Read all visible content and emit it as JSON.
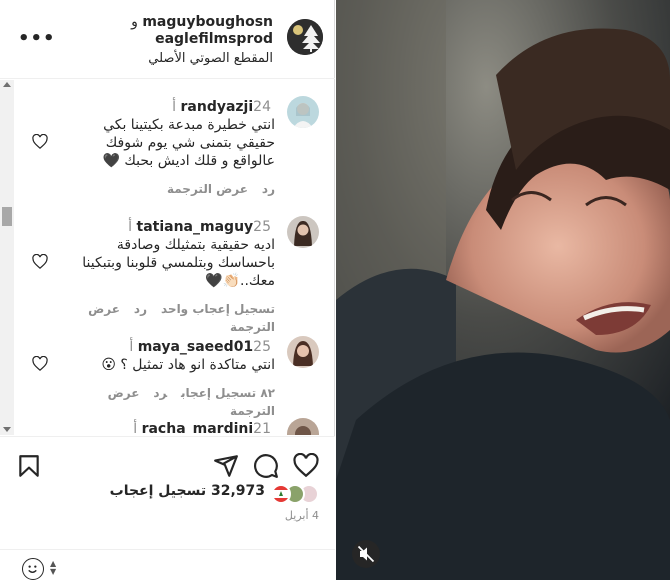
{
  "post": {
    "author_primary": "maguyboughosn",
    "conjunction": "و",
    "author_secondary": "eaglefilmsprod",
    "audio_label": "المقطع الصوتي الأصلي",
    "more_icon": "more-horizontal-icon"
  },
  "comments": [
    {
      "user": "randyazji",
      "time": "24 أ",
      "lines": [
        "انتي خطيرة مبدعة بكيتينا بكي",
        "حقيقي بتمنى شي يوم شوفك",
        "عالواقع و قلك اديش بحبك 🖤"
      ],
      "reply": "رد",
      "translate": "عرض الترجمة",
      "likes": ""
    },
    {
      "user": "tatiana_maguy",
      "time": "25 أ",
      "lines": [
        "اديه حقيقية بتمثيلك وصادقة",
        "باحساسك وبتلمسي قلوبنا وبتبكينا",
        "معك..👏🏻🖤"
      ],
      "likes": "تسجيل إعجاب واحد",
      "reply": "رد",
      "translate": "عرض الترجمة"
    },
    {
      "user": "maya_saeed01",
      "time": "25 أ",
      "lines": [
        "انتي متاكدة انو هاد تمثيل ؟ 😮"
      ],
      "likes": "٨٢ تسجيل إعجاب",
      "reply": "رد",
      "translate": "عرض الترجمة"
    },
    {
      "user": "racha_mardini",
      "time": "21 أ",
      "lines": [],
      "likes": "",
      "reply": "",
      "translate": ""
    }
  ],
  "actions": {
    "like_icon": "heart-icon",
    "comment_icon": "comment-icon",
    "share_icon": "send-icon",
    "save_icon": "bookmark-icon"
  },
  "likes_count": "32,973",
  "likes_label": "تسجيل إعجاب",
  "date": "4 أبريل",
  "emoji_icon": "emoji-icon",
  "media": {
    "mute_icon": "muted-speaker-icon"
  },
  "colors": {
    "text": "#262626",
    "secondary": "#8e8e8e",
    "border": "#dbdbdb"
  }
}
